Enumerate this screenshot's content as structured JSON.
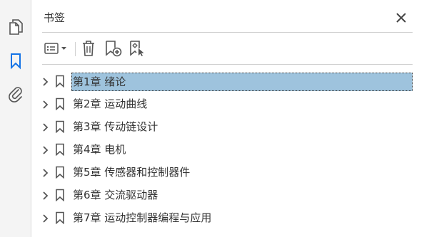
{
  "panel": {
    "title": "书签"
  },
  "left_rail": {
    "icons": [
      "pages-icon",
      "bookmark-icon",
      "attachment-icon"
    ],
    "active": "bookmark-icon",
    "accent_color": "#1473e6"
  },
  "toolbar": {
    "icons": [
      "options-menu-icon",
      "delete-icon",
      "new-bookmark-icon",
      "new-bookmark-from-structure-icon"
    ]
  },
  "bookmarks": [
    {
      "label": "第1章  绪论",
      "selected": true
    },
    {
      "label": "第2章  运动曲线",
      "selected": false
    },
    {
      "label": "第3章  传动链设计",
      "selected": false
    },
    {
      "label": "第4章  电机",
      "selected": false
    },
    {
      "label": "第5章  传感器和控制器件",
      "selected": false
    },
    {
      "label": "第6章  交流驱动器",
      "selected": false
    },
    {
      "label": "第7章  运动控制器编程与应用",
      "selected": false
    }
  ],
  "colors": {
    "selection": "#9ec3dd",
    "icon": "#555555"
  }
}
